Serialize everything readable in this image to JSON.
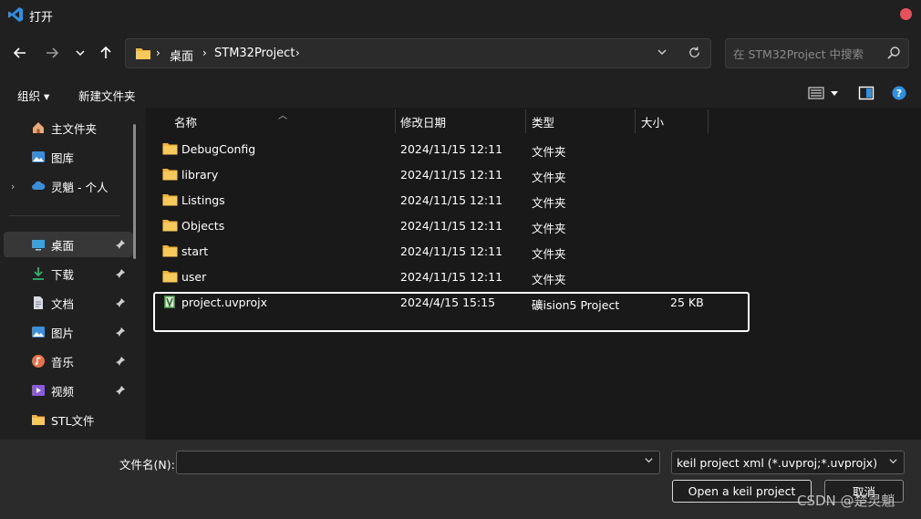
{
  "window": {
    "title": "打开"
  },
  "nav": {
    "path": [
      "桌面",
      "STM32Project"
    ],
    "search_placeholder": "在 STM32Project 中搜索"
  },
  "toolbar": {
    "organize_label": "组织 ▾",
    "new_folder_label": "新建文件夹"
  },
  "sidebar": {
    "items": [
      {
        "label": "主文件夹",
        "icon": "home-icon"
      },
      {
        "label": "图库",
        "icon": "gallery-icon"
      },
      {
        "label": "灵魈 - 个人",
        "icon": "cloud-icon"
      },
      {
        "label": "桌面",
        "icon": "desktop-icon",
        "active": true
      },
      {
        "label": "下载",
        "icon": "download-icon"
      },
      {
        "label": "文档",
        "icon": "document-icon"
      },
      {
        "label": "图片",
        "icon": "pictures-icon"
      },
      {
        "label": "音乐",
        "icon": "music-icon"
      },
      {
        "label": "视频",
        "icon": "video-icon"
      },
      {
        "label": "STL文件",
        "icon": "folder-icon"
      }
    ]
  },
  "columns": {
    "name": "名称",
    "date": "修改日期",
    "type": "类型",
    "size": "大小"
  },
  "files": [
    {
      "name": "DebugConfig",
      "date": "2024/11/15 12:11",
      "type": "文件夹",
      "size": "",
      "icon": "folder-icon"
    },
    {
      "name": "library",
      "date": "2024/11/15 12:11",
      "type": "文件夹",
      "size": "",
      "icon": "folder-icon"
    },
    {
      "name": "Listings",
      "date": "2024/11/15 12:11",
      "type": "文件夹",
      "size": "",
      "icon": "folder-icon"
    },
    {
      "name": "Objects",
      "date": "2024/11/15 12:11",
      "type": "文件夹",
      "size": "",
      "icon": "folder-icon"
    },
    {
      "name": "start",
      "date": "2024/11/15 12:11",
      "type": "文件夹",
      "size": "",
      "icon": "folder-icon"
    },
    {
      "name": "user",
      "date": "2024/11/15 12:11",
      "type": "文件夹",
      "size": "",
      "icon": "folder-icon"
    },
    {
      "name": "project.uvprojx",
      "date": "2024/4/15 15:15",
      "type": "礦ision5 Project",
      "size": "25 KB",
      "icon": "keil-project-icon"
    }
  ],
  "footer": {
    "filename_label": "文件名(N):",
    "filename_value": "",
    "filter_value": "keil project xml (*.uvproj;*.uvprojx)",
    "open_label": "Open a keil project",
    "cancel_label": "取消"
  },
  "watermark": "CSDN @楚灵魈",
  "colors": {
    "folder": "#f0b43c",
    "accent": "#2f8fe0",
    "close": "#e8505b"
  }
}
